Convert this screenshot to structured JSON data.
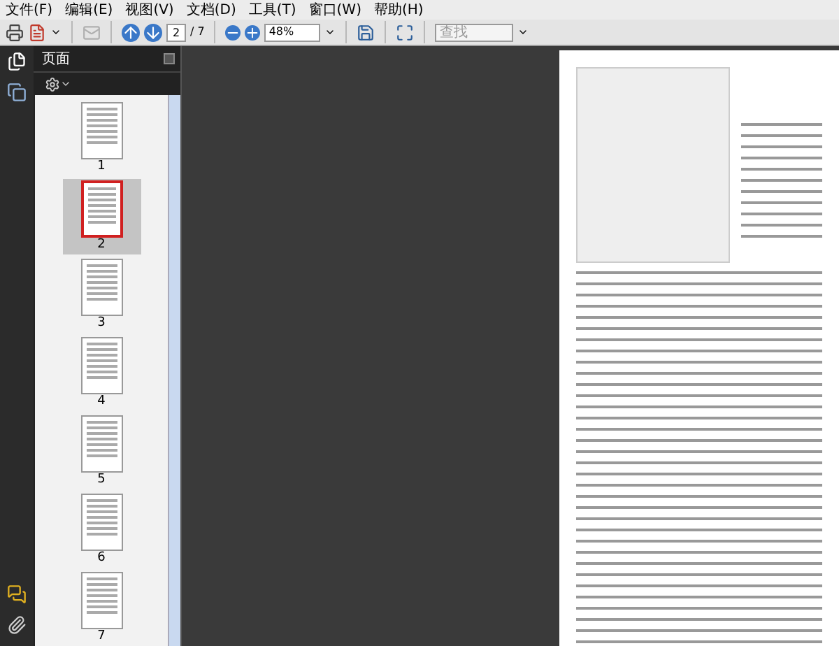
{
  "menu": [
    {
      "label": "文件(F)"
    },
    {
      "label": "编辑(E)"
    },
    {
      "label": "视图(V)"
    },
    {
      "label": "文档(D)"
    },
    {
      "label": "工具(T)"
    },
    {
      "label": "窗口(W)"
    },
    {
      "label": "帮助(H)"
    }
  ],
  "toolbar": {
    "page_number": "2",
    "page_count": "/ 7",
    "zoom": "48%",
    "search": {
      "placeholder": "查找"
    }
  },
  "panel": {
    "title": "页面"
  },
  "thumbnails": [
    {
      "label": "1",
      "selected": false
    },
    {
      "label": "2",
      "selected": true
    },
    {
      "label": "3",
      "selected": false
    },
    {
      "label": "4",
      "selected": false
    },
    {
      "label": "5",
      "selected": false
    },
    {
      "label": "6",
      "selected": false
    },
    {
      "label": "7",
      "selected": false
    }
  ]
}
